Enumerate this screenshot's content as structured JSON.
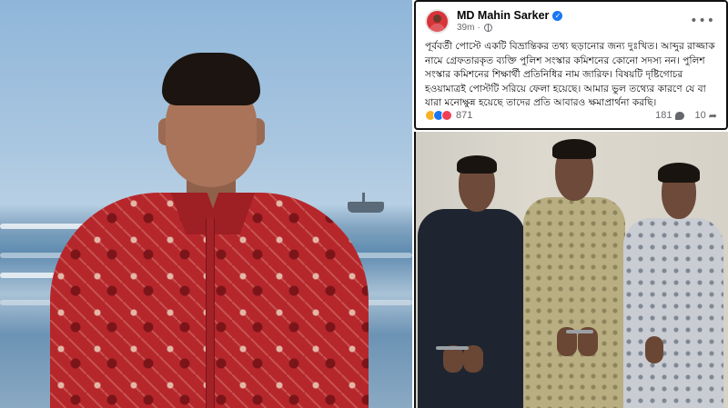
{
  "post": {
    "author_name": "MD Mahin Sarker",
    "verified_badge": "✓",
    "time": "39m",
    "separator": "·",
    "more_icon": "•••",
    "body": "পূর্ববর্তী পোস্টে একটি বিভ্রান্তিকর তথ্য ছড়ানোর জন্য দুঃখিত। আব্দুর রাজ্জাক নামে গ্রেফতারকৃত ব্যক্তি পুলিশ সংস্কার কমিশনের কোনো সদস্য নন। পুলিশ সংস্কার কমিশনের শিক্ষার্থী প্রতিনিধির নাম জারিফ। বিষয়টি দৃষ্টিগোচর হওয়ামাত্রই পোস্টটি সরিয়ে ফেলা হয়েছে। আমার ভুল তথ্যের কারণে যে বা যারা মনোক্ষুন্ন হয়েছে তাদের প্রতি আবারও ক্ষমাপ্রার্থনা করছি।",
    "reaction_count": "871",
    "comment_count": "181",
    "share_count": "10",
    "icons": {
      "reactions": [
        "haha-icon",
        "like-icon",
        "love-icon"
      ],
      "comment": "comment-icon",
      "share": "share-icon",
      "privacy": "globe-icon"
    }
  },
  "colors": {
    "facebook_blue": "#1877f2",
    "text_primary": "#050505",
    "text_secondary": "#65676b",
    "shirt_red": "#b6272c"
  }
}
